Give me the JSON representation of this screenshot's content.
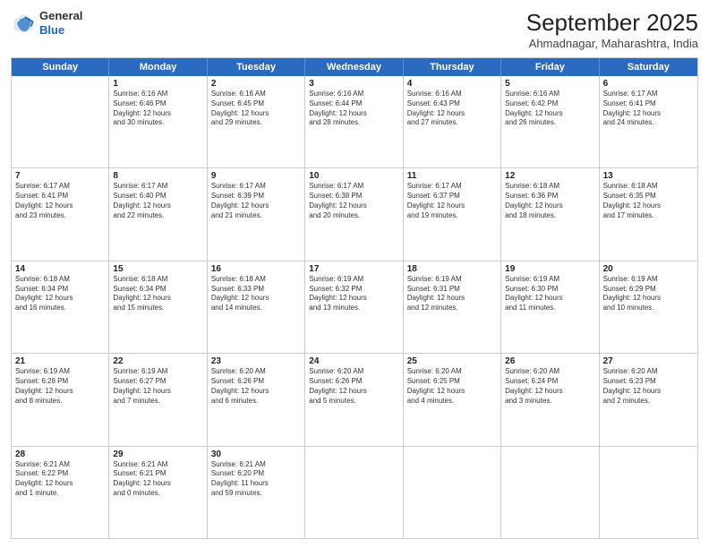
{
  "logo": {
    "general": "General",
    "blue": "Blue"
  },
  "title": "September 2025",
  "location": "Ahmadnagar, Maharashtra, India",
  "header_days": [
    "Sunday",
    "Monday",
    "Tuesday",
    "Wednesday",
    "Thursday",
    "Friday",
    "Saturday"
  ],
  "weeks": [
    [
      {
        "day": "",
        "info": ""
      },
      {
        "day": "1",
        "info": "Sunrise: 6:16 AM\nSunset: 6:46 PM\nDaylight: 12 hours\nand 30 minutes."
      },
      {
        "day": "2",
        "info": "Sunrise: 6:16 AM\nSunset: 6:45 PM\nDaylight: 12 hours\nand 29 minutes."
      },
      {
        "day": "3",
        "info": "Sunrise: 6:16 AM\nSunset: 6:44 PM\nDaylight: 12 hours\nand 28 minutes."
      },
      {
        "day": "4",
        "info": "Sunrise: 6:16 AM\nSunset: 6:43 PM\nDaylight: 12 hours\nand 27 minutes."
      },
      {
        "day": "5",
        "info": "Sunrise: 6:16 AM\nSunset: 6:42 PM\nDaylight: 12 hours\nand 26 minutes."
      },
      {
        "day": "6",
        "info": "Sunrise: 6:17 AM\nSunset: 6:41 PM\nDaylight: 12 hours\nand 24 minutes."
      }
    ],
    [
      {
        "day": "7",
        "info": "Sunrise: 6:17 AM\nSunset: 6:41 PM\nDaylight: 12 hours\nand 23 minutes."
      },
      {
        "day": "8",
        "info": "Sunrise: 6:17 AM\nSunset: 6:40 PM\nDaylight: 12 hours\nand 22 minutes."
      },
      {
        "day": "9",
        "info": "Sunrise: 6:17 AM\nSunset: 6:39 PM\nDaylight: 12 hours\nand 21 minutes."
      },
      {
        "day": "10",
        "info": "Sunrise: 6:17 AM\nSunset: 6:38 PM\nDaylight: 12 hours\nand 20 minutes."
      },
      {
        "day": "11",
        "info": "Sunrise: 6:17 AM\nSunset: 6:37 PM\nDaylight: 12 hours\nand 19 minutes."
      },
      {
        "day": "12",
        "info": "Sunrise: 6:18 AM\nSunset: 6:36 PM\nDaylight: 12 hours\nand 18 minutes."
      },
      {
        "day": "13",
        "info": "Sunrise: 6:18 AM\nSunset: 6:35 PM\nDaylight: 12 hours\nand 17 minutes."
      }
    ],
    [
      {
        "day": "14",
        "info": "Sunrise: 6:18 AM\nSunset: 6:34 PM\nDaylight: 12 hours\nand 16 minutes."
      },
      {
        "day": "15",
        "info": "Sunrise: 6:18 AM\nSunset: 6:34 PM\nDaylight: 12 hours\nand 15 minutes."
      },
      {
        "day": "16",
        "info": "Sunrise: 6:18 AM\nSunset: 6:33 PM\nDaylight: 12 hours\nand 14 minutes."
      },
      {
        "day": "17",
        "info": "Sunrise: 6:19 AM\nSunset: 6:32 PM\nDaylight: 12 hours\nand 13 minutes."
      },
      {
        "day": "18",
        "info": "Sunrise: 6:19 AM\nSunset: 6:31 PM\nDaylight: 12 hours\nand 12 minutes."
      },
      {
        "day": "19",
        "info": "Sunrise: 6:19 AM\nSunset: 6:30 PM\nDaylight: 12 hours\nand 11 minutes."
      },
      {
        "day": "20",
        "info": "Sunrise: 6:19 AM\nSunset: 6:29 PM\nDaylight: 12 hours\nand 10 minutes."
      }
    ],
    [
      {
        "day": "21",
        "info": "Sunrise: 6:19 AM\nSunset: 6:28 PM\nDaylight: 12 hours\nand 8 minutes."
      },
      {
        "day": "22",
        "info": "Sunrise: 6:19 AM\nSunset: 6:27 PM\nDaylight: 12 hours\nand 7 minutes."
      },
      {
        "day": "23",
        "info": "Sunrise: 6:20 AM\nSunset: 6:26 PM\nDaylight: 12 hours\nand 6 minutes."
      },
      {
        "day": "24",
        "info": "Sunrise: 6:20 AM\nSunset: 6:26 PM\nDaylight: 12 hours\nand 5 minutes."
      },
      {
        "day": "25",
        "info": "Sunrise: 6:20 AM\nSunset: 6:25 PM\nDaylight: 12 hours\nand 4 minutes."
      },
      {
        "day": "26",
        "info": "Sunrise: 6:20 AM\nSunset: 6:24 PM\nDaylight: 12 hours\nand 3 minutes."
      },
      {
        "day": "27",
        "info": "Sunrise: 6:20 AM\nSunset: 6:23 PM\nDaylight: 12 hours\nand 2 minutes."
      }
    ],
    [
      {
        "day": "28",
        "info": "Sunrise: 6:21 AM\nSunset: 6:22 PM\nDaylight: 12 hours\nand 1 minute."
      },
      {
        "day": "29",
        "info": "Sunrise: 6:21 AM\nSunset: 6:21 PM\nDaylight: 12 hours\nand 0 minutes."
      },
      {
        "day": "30",
        "info": "Sunrise: 6:21 AM\nSunset: 6:20 PM\nDaylight: 11 hours\nand 59 minutes."
      },
      {
        "day": "",
        "info": ""
      },
      {
        "day": "",
        "info": ""
      },
      {
        "day": "",
        "info": ""
      },
      {
        "day": "",
        "info": ""
      }
    ]
  ]
}
